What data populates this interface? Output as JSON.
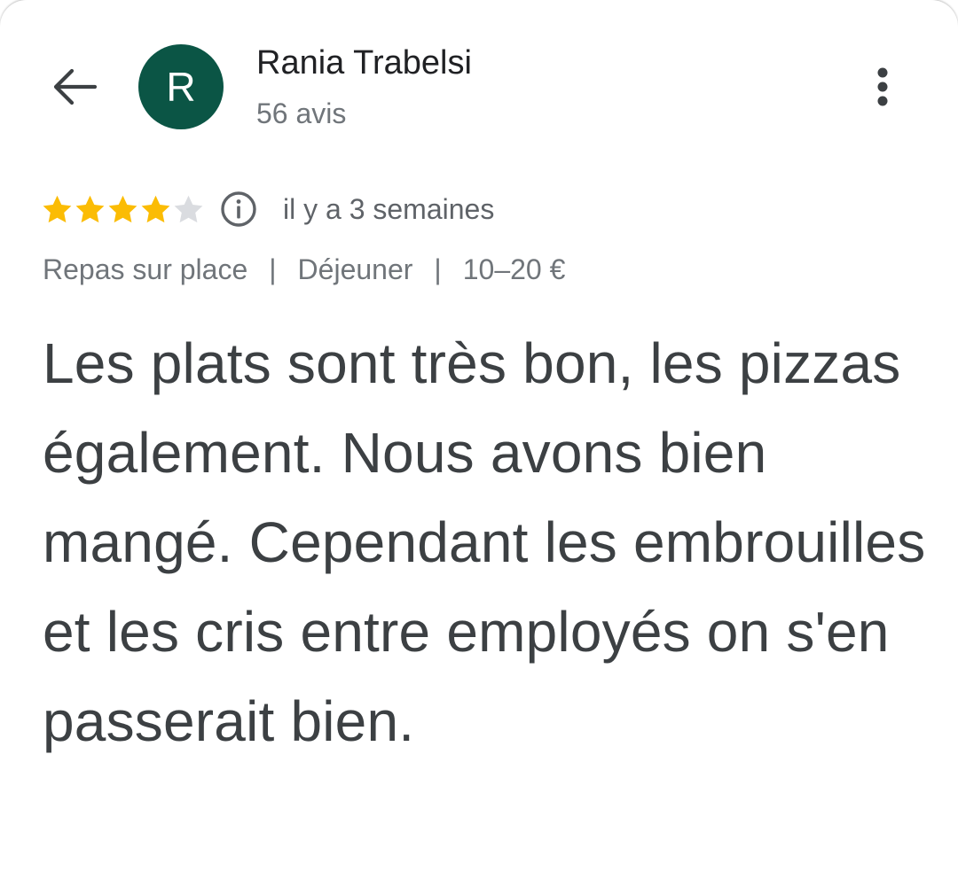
{
  "reviewer": {
    "initial": "R",
    "avatar_color": "#0b5545",
    "name": "Rania Trabelsi",
    "review_count": "56 avis"
  },
  "icons": {
    "back": "arrow-left-icon",
    "more": "more-vert-icon",
    "info": "info-icon",
    "star": "star-icon"
  },
  "rating": {
    "value": 4,
    "max": 5,
    "filled_color": "#fbbc04",
    "empty_color": "#dadce0",
    "date": "il y a 3 semaines"
  },
  "meta": {
    "service": "Repas sur place",
    "meal": "Déjeuner",
    "price": "10–20 €",
    "separator": "|"
  },
  "review": {
    "text": "Les plats sont très bon, les pizzas également. Nous avons bien mangé. Cependant les embrouilles et les cris entre employés on s'en passerait bien."
  }
}
